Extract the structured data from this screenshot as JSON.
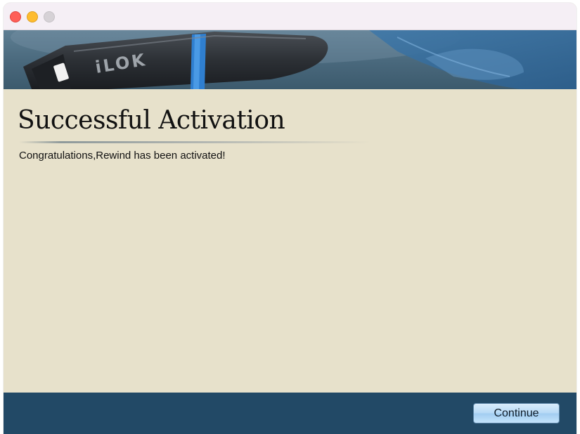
{
  "window": {
    "controls": [
      {
        "name": "close",
        "color": "#fe5f57"
      },
      {
        "name": "minimize",
        "color": "#febc2e"
      },
      {
        "name": "zoom",
        "color": "#d6d2d6"
      }
    ]
  },
  "banner": {
    "image": "ilok-usb-key-banner",
    "logo_text": "iLOK"
  },
  "main": {
    "title": "Successful Activation",
    "message": "Congratulations,Rewind has been activated!"
  },
  "footer": {
    "continue_label": "Continue",
    "background": "#224966"
  }
}
